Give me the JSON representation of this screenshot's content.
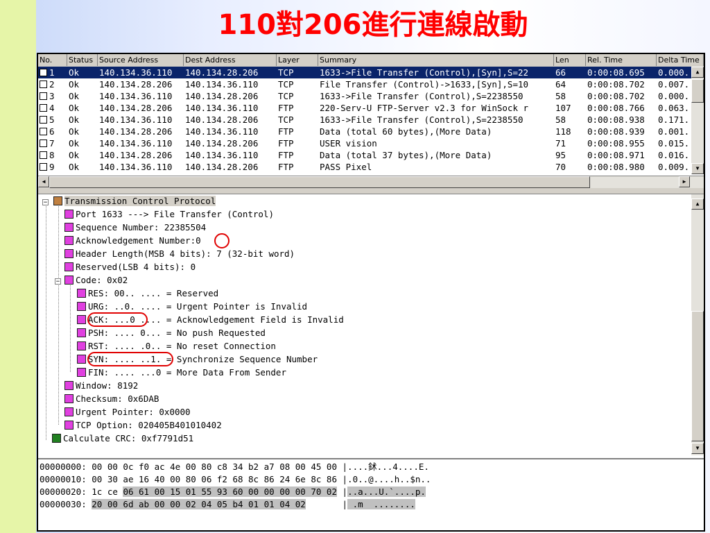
{
  "slide": {
    "title": "110對206進行連線啟動"
  },
  "packet_list": {
    "columns": [
      "No.",
      "Status",
      "Source Address",
      "Dest Address",
      "Layer",
      "Summary",
      "Len",
      "Rel. Time",
      "Delta Time"
    ],
    "rows": [
      {
        "no": "1",
        "status": "Ok",
        "src": "140.134.36.110",
        "dst": "140.134.28.206",
        "layer": "TCP",
        "summary": "1633->File Transfer (Control),[Syn],S=22",
        "len": "66",
        "rel": "0:00:08.695",
        "delta": "0.000."
      },
      {
        "no": "2",
        "status": "Ok",
        "src": "140.134.28.206",
        "dst": "140.134.36.110",
        "layer": "TCP",
        "summary": "File Transfer (Control)->1633,[Syn],S=10",
        "len": "64",
        "rel": "0:00:08.702",
        "delta": "0.007."
      },
      {
        "no": "3",
        "status": "Ok",
        "src": "140.134.36.110",
        "dst": "140.134.28.206",
        "layer": "TCP",
        "summary": "1633->File Transfer (Control),S=2238550",
        "len": "58",
        "rel": "0:00:08.702",
        "delta": "0.000."
      },
      {
        "no": "4",
        "status": "Ok",
        "src": "140.134.28.206",
        "dst": "140.134.36.110",
        "layer": "FTP",
        "summary": "220-Serv-U FTP-Server v2.3 for WinSock r",
        "len": "107",
        "rel": "0:00:08.766",
        "delta": "0.063."
      },
      {
        "no": "5",
        "status": "Ok",
        "src": "140.134.36.110",
        "dst": "140.134.28.206",
        "layer": "TCP",
        "summary": "1633->File Transfer (Control),S=2238550",
        "len": "58",
        "rel": "0:00:08.938",
        "delta": "0.171."
      },
      {
        "no": "6",
        "status": "Ok",
        "src": "140.134.28.206",
        "dst": "140.134.36.110",
        "layer": "FTP",
        "summary": "Data (total 60 bytes),(More Data)",
        "len": "118",
        "rel": "0:00:08.939",
        "delta": "0.001."
      },
      {
        "no": "7",
        "status": "Ok",
        "src": "140.134.36.110",
        "dst": "140.134.28.206",
        "layer": "FTP",
        "summary": "USER vision",
        "len": "71",
        "rel": "0:00:08.955",
        "delta": "0.015."
      },
      {
        "no": "8",
        "status": "Ok",
        "src": "140.134.28.206",
        "dst": "140.134.36.110",
        "layer": "FTP",
        "summary": "Data (total 37 bytes),(More Data)",
        "len": "95",
        "rel": "0:00:08.971",
        "delta": "0.016."
      },
      {
        "no": "9",
        "status": "Ok",
        "src": "140.134.36.110",
        "dst": "140.134.28.206",
        "layer": "FTP",
        "summary": "PASS Pixel",
        "len": "70",
        "rel": "0:00:08.980",
        "delta": "0.009."
      }
    ]
  },
  "tree": {
    "root": "Transmission Control Protocol",
    "port": "Port 1633 ---> File Transfer (Control)",
    "seq": "Sequence Number: 22385504",
    "ack_label": "Acknowledgement Number:",
    "ack_value": "0",
    "hdrlen": "Header Length(MSB 4 bits): 7 (32-bit word)",
    "reserved": "Reserved(LSB 4 bits): 0",
    "code": "Code: 0x02",
    "res": "RES: 00.. .... = Reserved",
    "urg": "URG: ..0. .... = Urgent Pointer is Invalid",
    "ack_flag": "ACK: ...0",
    "ack_flag_rest": " .... = Acknowledgement Field is Invalid",
    "psh": "PSH: .... 0... = No push Requested",
    "rst": "RST: .... .0.. = No reset Connection",
    "syn_flag": "SYN: .... ..1.",
    "syn_flag_rest": " = Synchronize Sequence Number",
    "fin": "FIN: .... ...0 = More Data From Sender",
    "window": "Window: 8192",
    "checksum": "Checksum: 0x6DAB",
    "urgent": "Urgent Pointer: 0x0000",
    "option": "TCP Option: 020405B401010402",
    "crc": "Calculate CRC: 0xf7791d51"
  },
  "hex": {
    "r0_off": "00000000:",
    "r0_bytes": "00 00 0c f0 ac 4e 00 80 c8 34 b2 a7 08 00 45 00",
    "r0_ascii": "|....鉥...4....E.",
    "r1_off": "00000010:",
    "r1_bytes": "00 30 ae 16 40 00 80 06 f2 68 8c 86 24 6e 8c 86",
    "r1_ascii": "|.0..@....h..$n..",
    "r2_off": "00000020:",
    "r2_pre": "1c ce",
    "r2_bytes": "06 61 00 15 01 55 93 60 00 00 00 00 70 02",
    "r2_bar": "|",
    "r2_ascii": "..a...U.`....p.",
    "r3_off": "00000030:",
    "r3_bytes": "20 00 6d ab 00 00 02 04 05 b4 01 01 04 02",
    "r3_bar": "|",
    "r3_ascii": " .m  ........"
  }
}
